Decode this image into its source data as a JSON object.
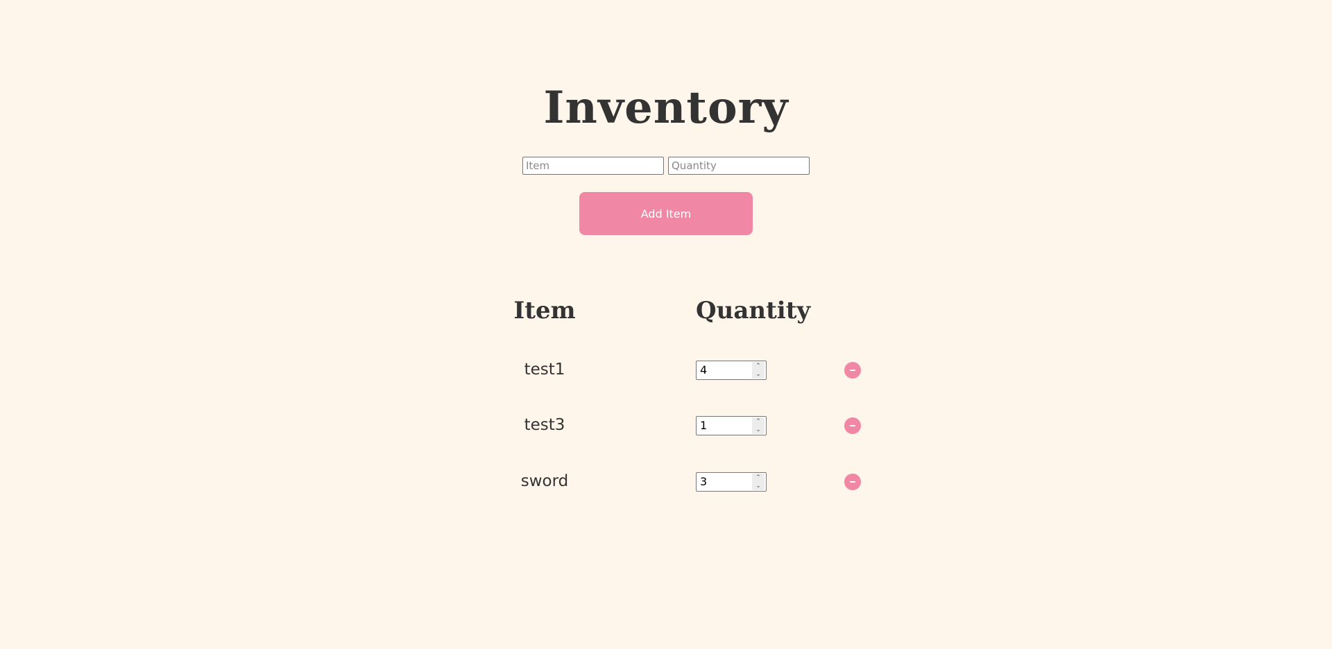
{
  "page": {
    "title": "Inventory"
  },
  "form": {
    "item_placeholder": "Item",
    "item_value": "",
    "quantity_placeholder": "Quantity",
    "quantity_value": "",
    "add_button_label": "Add Item"
  },
  "table": {
    "headers": {
      "item": "Item",
      "quantity": "Quantity"
    },
    "rows": [
      {
        "name": "test1",
        "quantity": "4",
        "remove_icon": "minus-circle-icon"
      },
      {
        "name": "test3",
        "quantity": "1",
        "remove_icon": "minus-circle-icon"
      },
      {
        "name": "sword",
        "quantity": "3",
        "remove_icon": "minus-circle-icon"
      }
    ]
  },
  "colors": {
    "background": "#fff6eb",
    "accent": "#f088a5",
    "text": "#333333"
  }
}
